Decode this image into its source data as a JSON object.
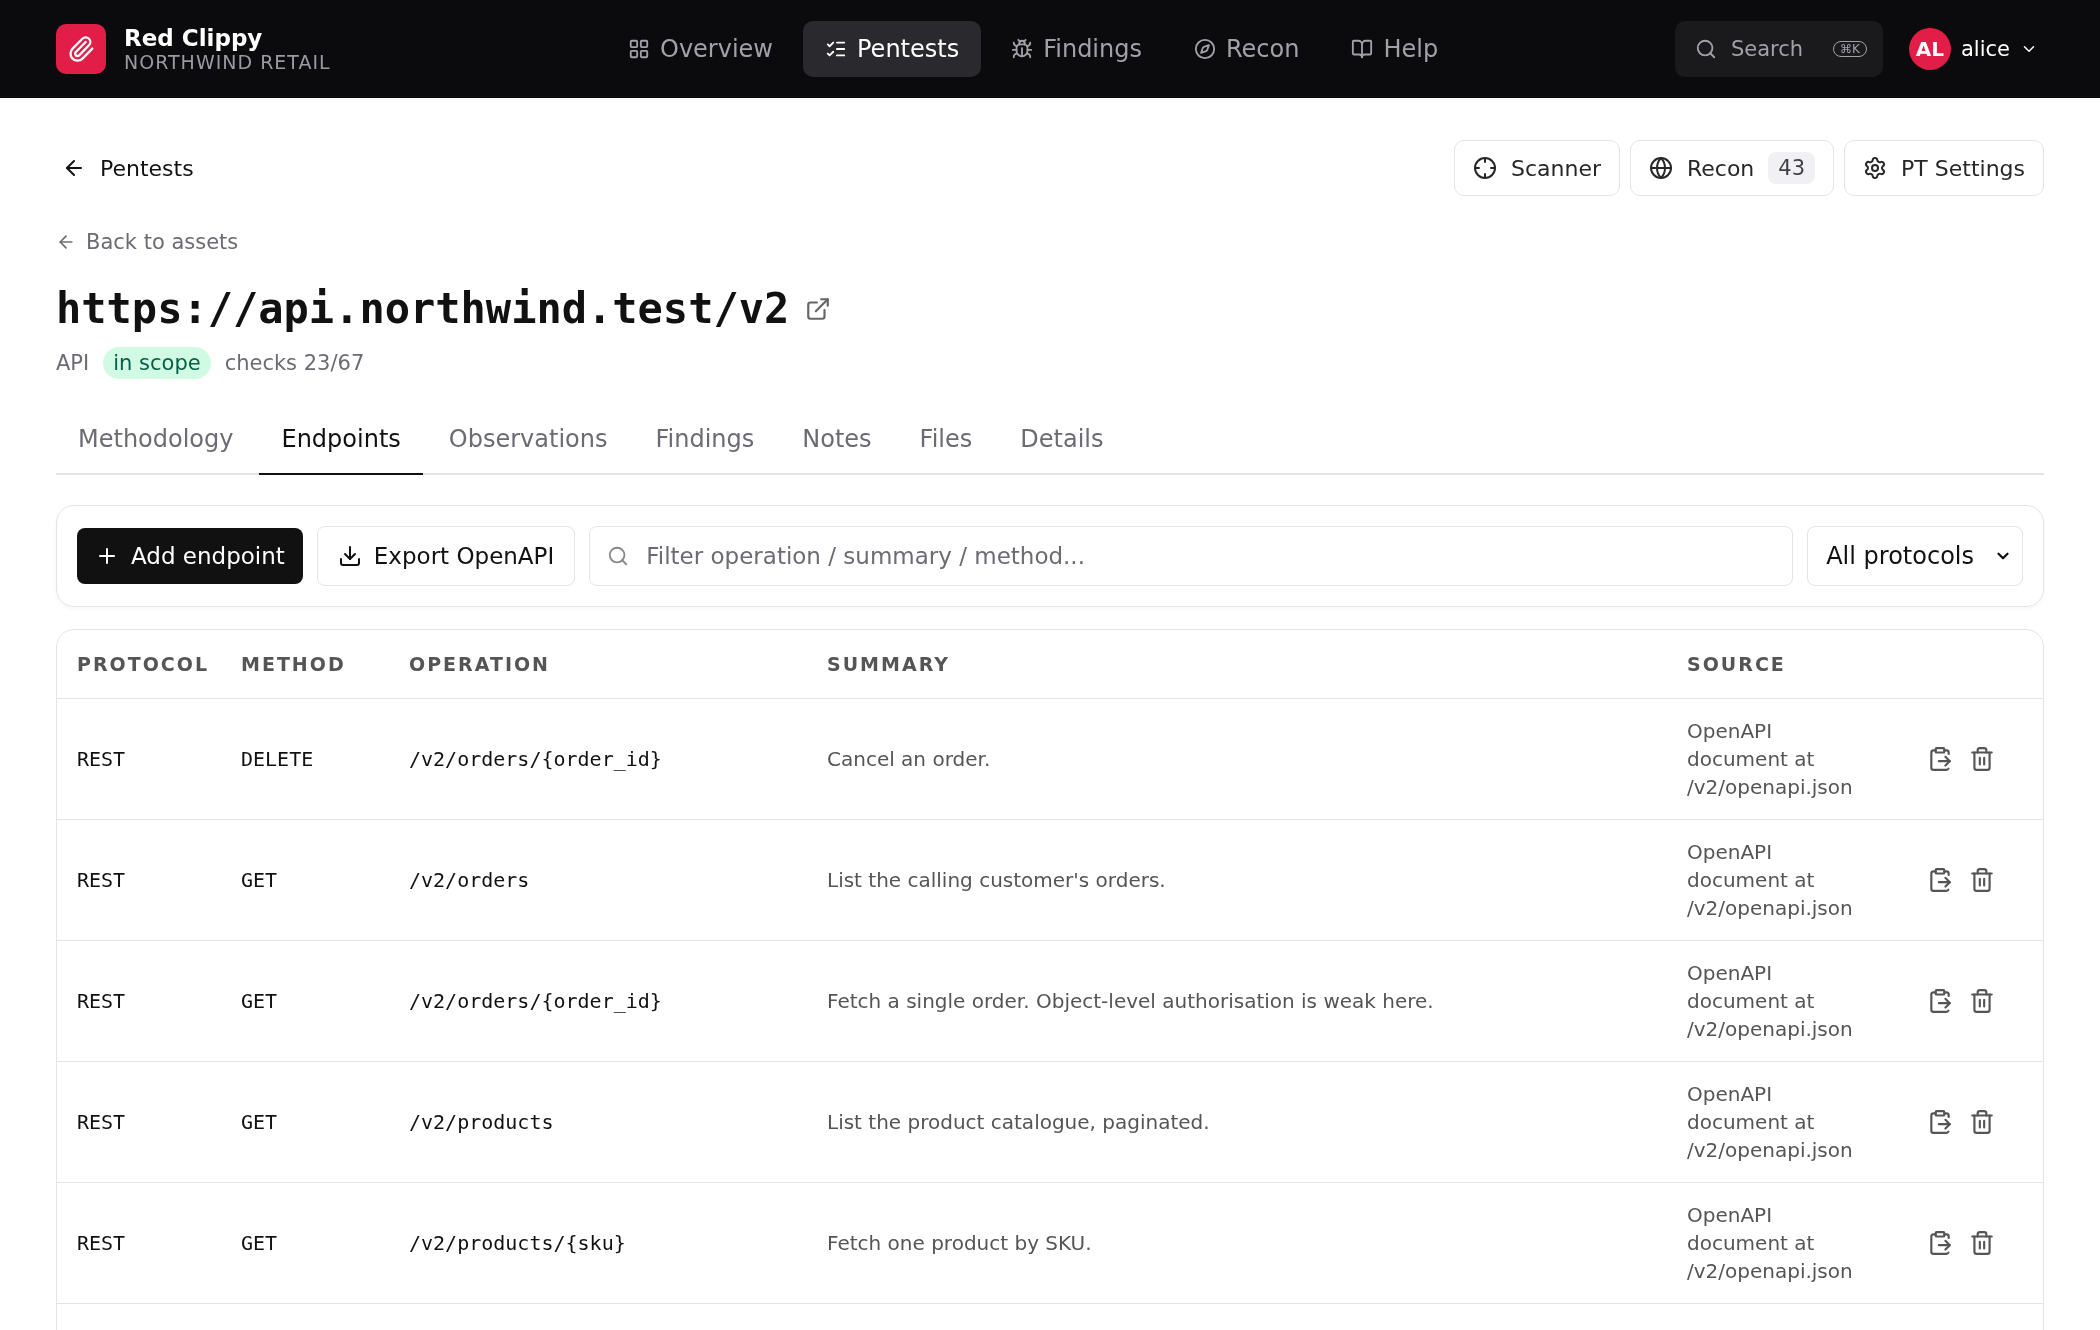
{
  "brand": {
    "name": "Red Clippy",
    "org": "NORTHWIND RETAIL"
  },
  "nav": [
    {
      "label": "Overview",
      "selected": false
    },
    {
      "label": "Pentests",
      "selected": true
    },
    {
      "label": "Findings",
      "selected": false
    },
    {
      "label": "Recon",
      "selected": false
    },
    {
      "label": "Help",
      "selected": false
    }
  ],
  "search": {
    "placeholder": "Search",
    "shortcut": "⌘K"
  },
  "user": {
    "initials": "AL",
    "name": "alice"
  },
  "breadcrumb": "Pentests",
  "actions": [
    {
      "label": "Scanner"
    },
    {
      "label": "Recon",
      "count": "43"
    },
    {
      "label": "PT Settings"
    }
  ],
  "back_link": "Back to assets",
  "asset": {
    "title": "https://api.northwind.test/v2",
    "type": "API",
    "scope": "in scope",
    "checks": "checks 23/67"
  },
  "tabs": [
    {
      "label": "Methodology",
      "selected": false
    },
    {
      "label": "Endpoints",
      "selected": true
    },
    {
      "label": "Observations",
      "selected": false
    },
    {
      "label": "Findings",
      "selected": false
    },
    {
      "label": "Notes",
      "selected": false
    },
    {
      "label": "Files",
      "selected": false
    },
    {
      "label": "Details",
      "selected": false
    }
  ],
  "toolbar": {
    "add": "Add endpoint",
    "export": "Export OpenAPI",
    "filter_placeholder": "Filter operation / summary / method...",
    "protocol": "All protocols"
  },
  "table": {
    "columns": [
      "PROTOCOL",
      "METHOD",
      "OPERATION",
      "SUMMARY",
      "SOURCE"
    ],
    "rows": [
      {
        "protocol": "REST",
        "method": "DELETE",
        "operation": "/v2/orders/{order_id}",
        "summary": "Cancel an order.",
        "source": "OpenAPI document at /v2/openapi.json"
      },
      {
        "protocol": "REST",
        "method": "GET",
        "operation": "/v2/orders",
        "summary": "List the calling customer's orders.",
        "source": "OpenAPI document at /v2/openapi.json"
      },
      {
        "protocol": "REST",
        "method": "GET",
        "operation": "/v2/orders/{order_id}",
        "summary": "Fetch a single order. Object-level authorisation is weak here.",
        "source": "OpenAPI document at /v2/openapi.json"
      },
      {
        "protocol": "REST",
        "method": "GET",
        "operation": "/v2/products",
        "summary": "List the product catalogue, paginated.",
        "source": "OpenAPI document at /v2/openapi.json"
      },
      {
        "protocol": "REST",
        "method": "GET",
        "operation": "/v2/products/{sku}",
        "summary": "Fetch one product by SKU.",
        "source": "OpenAPI document at /v2/openapi.json"
      }
    ]
  }
}
